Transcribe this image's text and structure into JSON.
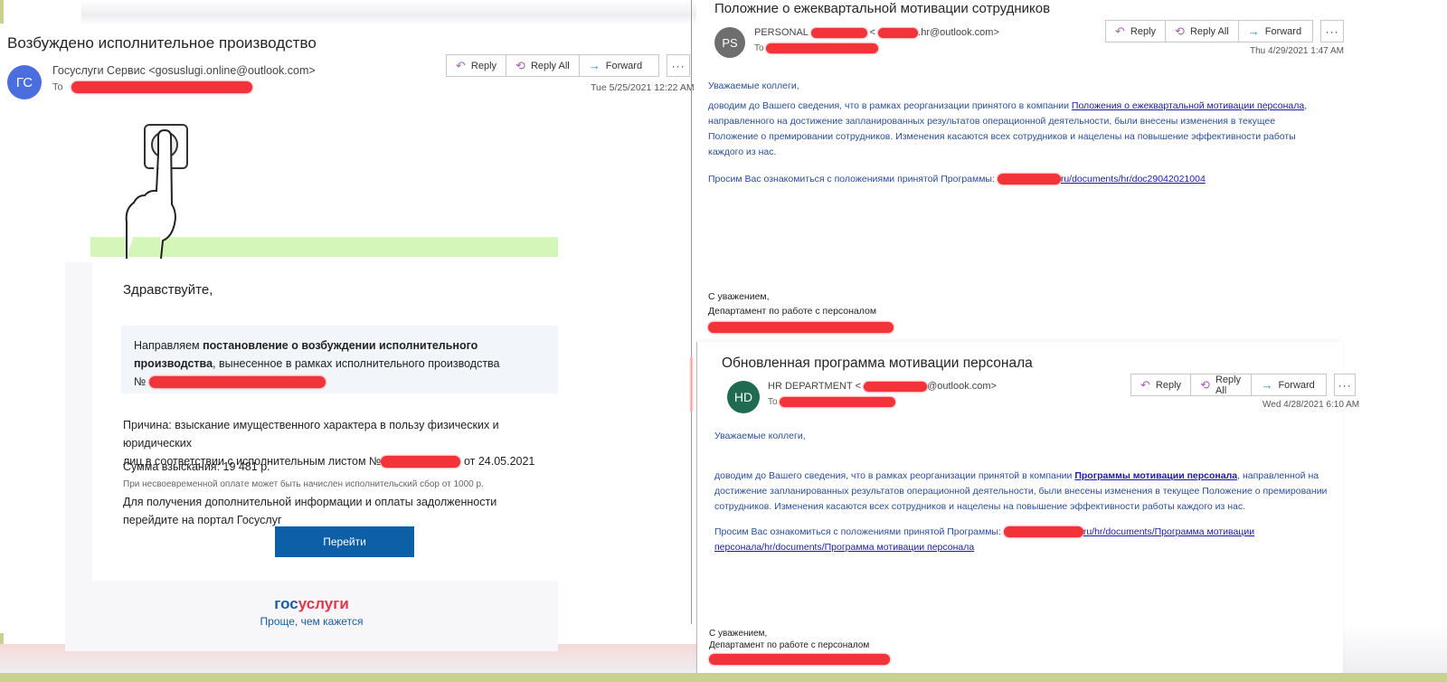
{
  "emails": [
    {
      "subject": "Возбуждено исполнительное производство",
      "avatar_initials": "ГС",
      "avatar_color": "#4a6ee0",
      "from_display": "Госуслуги Сервис <gosuslugi.online@outlook.com>",
      "to_label": "To",
      "date": "Tue 5/25/2021 12:22 AM",
      "actions": {
        "reply": "Reply",
        "reply_all": "Reply All",
        "forward": "Forward",
        "more": "···"
      },
      "body": {
        "greeting": "Здравствуйте,",
        "box_text_1": "Направляем ",
        "box_bold": "постановление о возбуждении исполнительного производства",
        "box_text_2": ", вынесенное в рамках исполнительного производства",
        "box_number_prefix": "№",
        "reason_1": "Причина: взыскание имущественного характера в пользу физических и юридических",
        "reason_2": "лиц в соответствии с исполнительным листом №",
        "reason_date": "от 24.05.2021",
        "amount": "Сумма взыскания: 19 481 р.",
        "late_fee_note": "При несвоевременной оплате может быть начислен исполнительский сбор от 1000 р.",
        "more_info": "Для получения дополнительной информации и оплаты задолженности перейдите на портал Госуслуг",
        "button": "Перейти",
        "logo_part1": "гос",
        "logo_part2": "услуги",
        "slogan": "Проще, чем кажется"
      }
    },
    {
      "subject": "Положние о ежеквартальной мотивации сотрудников",
      "avatar_initials": "PS",
      "avatar_color": "#6e6e6e",
      "from_prefix": "PERSONAL",
      "from_lt": "<",
      "from_suffix": ".hr@outlook.com>",
      "to_label": "To",
      "date": "Thu 4/29/2021 1:47 AM",
      "actions": {
        "reply": "Reply",
        "reply_all": "Reply All",
        "forward": "Forward",
        "more": "···"
      },
      "body": {
        "greeting": "Уважаемые коллеги,",
        "p1_a": "доводим до Вашего сведения, что в рамках реорганизации принятого в компании ",
        "p1_link": "Положения о ежеквартальной мотивации персонала",
        "p1_b": ", направленного на достижение запланированных результатов операционной деятельности, были внесены изменения в текущее  Положение о премировании сотрудников. Изменения касаются всех сотрудников и нацелены на повышение эффективности работы каждого из нас.",
        "p2": "Просим Вас ознакомиться с положениями принятой Программы:",
        "p2_link": "ru/documents/hr/doc29042021004",
        "sign_1": "С уважением,",
        "sign_2": "Департамент по работе с персоналом"
      }
    },
    {
      "subject": "Обновленная программа мотивации персонала",
      "avatar_initials": "HD",
      "avatar_color": "#1e6b52",
      "from_prefix": "HR DEPARTMENT <",
      "from_suffix": "@outlook.com>",
      "to_label": "To",
      "date": "Wed 4/28/2021 6:10 AM",
      "actions": {
        "reply": "Reply",
        "reply_all": "Reply All",
        "forward": "Forward",
        "more": "···"
      },
      "body": {
        "greeting": "Уважаемые коллеги,",
        "p1_a": "доводим до Вашего сведения, что в рамках реорганизации принятой в компании ",
        "p1_link": "Программы мотивации персонала",
        "p1_b": ", направленной на достижение запланированных результатов операционной деятельности, были внесены изменения в текущее  Положение о премировании сотрудников. Изменения касаются всех сотрудников и нацелены на повышение эффективности работы каждого из нас.",
        "p2": "Просим Вас ознакомиться с положениями принятой Программы:",
        "p2_link_1": "ru/hr/documents/Программа мотивации",
        "p2_link_2": "персонала/hr/documents/Программа мотивации персонала",
        "sign_1": "С уважением,",
        "sign_2": "Департамент по работе с персоналом"
      }
    }
  ]
}
